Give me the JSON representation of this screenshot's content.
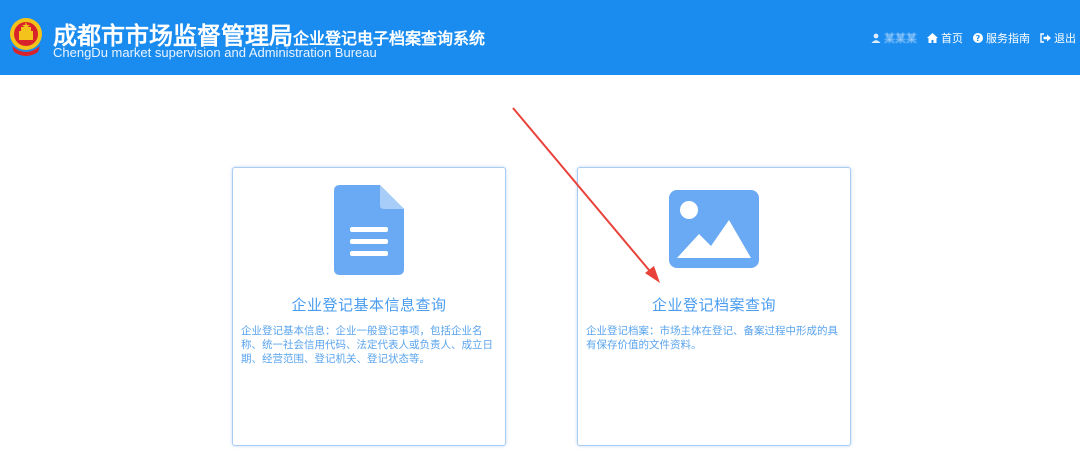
{
  "header": {
    "title_main": "成都市市场监督管理局",
    "title_sub": "企业登记电子档案查询系统",
    "title_en": "ChengDu market supervision and Administration Bureau",
    "background_color": "#1a8cf0"
  },
  "nav": {
    "user_name": "某某某",
    "home_label": "首页",
    "guide_label": "服务指南",
    "logout_label": "退出"
  },
  "cards": [
    {
      "title": "企业登记基本信息查询",
      "description": "企业登记基本信息：企业一般登记事项，包括企业名称、统一社会信用代码、法定代表人或负责人、成立日期、经营范围、登记机关、登记状态等。",
      "icon": "document-icon"
    },
    {
      "title": "企业登记档案查询",
      "description": "企业登记档案：市场主体在登记、备案过程中形成的具有保存价值的文件资料。",
      "icon": "image-icon"
    }
  ],
  "annotation": {
    "arrow_color": "#e8423a"
  }
}
